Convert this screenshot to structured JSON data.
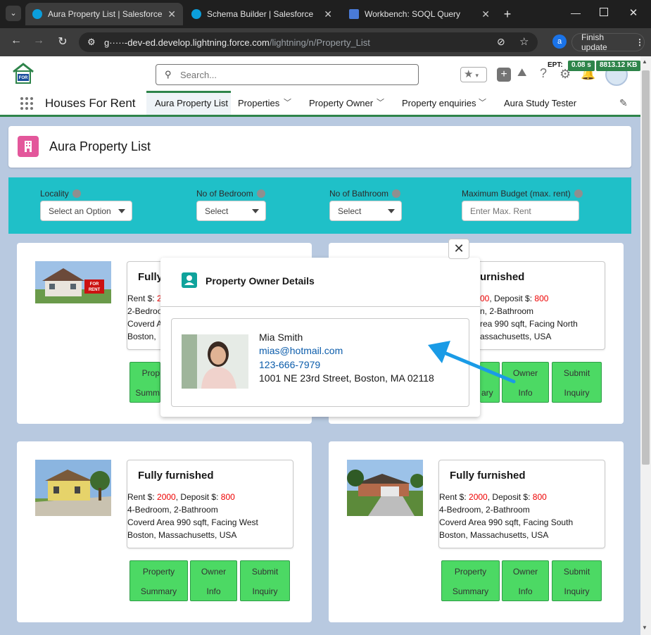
{
  "browser": {
    "tabs": [
      {
        "title": "Aura Property List | Salesforce",
        "active": true
      },
      {
        "title": "Schema Builder | Salesforce",
        "active": false
      },
      {
        "title": "Workbench: SOQL Query",
        "active": false
      }
    ],
    "url_host": "g·····-dev-ed.develop.lightning.force.com",
    "url_path": "/lightning/n/Property_List",
    "profile_initial": "a",
    "finish_update_label": "Finish update"
  },
  "sf_header": {
    "search_placeholder": "Search...",
    "ept_label": "EPT:",
    "ept_value": "0.08 s",
    "size_value": "8813.12 KB"
  },
  "nav": {
    "app_name": "Houses For Rent",
    "items": [
      {
        "label": "Aura Property List",
        "active": true,
        "has_menu": false
      },
      {
        "label": "Properties",
        "active": false,
        "has_menu": true
      },
      {
        "label": "Property Owner",
        "active": false,
        "has_menu": true
      },
      {
        "label": "Property enquiries",
        "active": false,
        "has_menu": true
      },
      {
        "label": "Aura Study Tester",
        "active": false,
        "has_menu": false
      }
    ]
  },
  "page": {
    "title": "Aura Property List",
    "filters": [
      {
        "label": "Locality",
        "value": "Select an Option"
      },
      {
        "label": "No of Bedroom",
        "value": "Select"
      },
      {
        "label": "No of Bathroom",
        "value": "Select"
      },
      {
        "label": "Maximum Budget (max. rent)",
        "placeholder": "Enter Max. Rent"
      }
    ]
  },
  "properties": [
    {
      "heading": "Fully",
      "rent_label": "Rent $: ",
      "rent": "2",
      "l2": "2-Bedroo",
      "l3": "Coverd A",
      "l4": "Boston, ",
      "btn1": "Prop",
      "btn1b": "Summ"
    },
    {
      "heading": "urnished",
      "rent": "00",
      "deposit_label": ", Deposit $: ",
      "deposit": "800",
      "l2": "n, 2-Bathroom",
      "l3": "rea 990 sqft, Facing North",
      "l4": "assachusetts, USA",
      "btn2": "Owner",
      "btn2b": "Info",
      "btn3": "Submit",
      "btn3b": "Inquiry",
      "btn1b": "ary"
    },
    {
      "heading": "Fully furnished",
      "rent_label": "Rent $: ",
      "rent": "2000",
      "deposit_label": ", Deposit $: ",
      "deposit": "800",
      "l2": "4-Bedroom, 2-Bathroom",
      "l3": "Coverd Area 990 sqft, Facing West",
      "l4": "Boston, Massachusetts, USA",
      "btn1": "Property",
      "btn1b": "Summary",
      "btn2": "Owner",
      "btn2b": "Info",
      "btn3": "Submit",
      "btn3b": "Inquiry"
    },
    {
      "heading": "Fully furnished",
      "rent_label": "Rent $: ",
      "rent": "2000",
      "deposit_label": ", Deposit $: ",
      "deposit": "800",
      "l2": "4-Bedroom, 2-Bathroom",
      "l3": "Coverd Area 990 sqft, Facing South",
      "l4": "Boston, Massachusetts, USA",
      "btn1": "Property",
      "btn1b": "Summary",
      "btn2": "Owner",
      "btn2b": "Info",
      "btn3": "Submit",
      "btn3b": "Inquiry"
    }
  ],
  "modal": {
    "title": "Property Owner Details",
    "close_symbol": "✕",
    "owner_name": "Mia Smith",
    "owner_email": "mias@hotmail.com",
    "owner_phone": "123-666-7979",
    "owner_address": "1001 NE 23rd Street, Boston, MA 02118"
  },
  "colors": {
    "accent_green": "#2e844a",
    "filter_bar": "#1fc0c8",
    "button_green": "#4cd964",
    "arrow_blue": "#1a9be6",
    "price_red": "#ee0000"
  }
}
